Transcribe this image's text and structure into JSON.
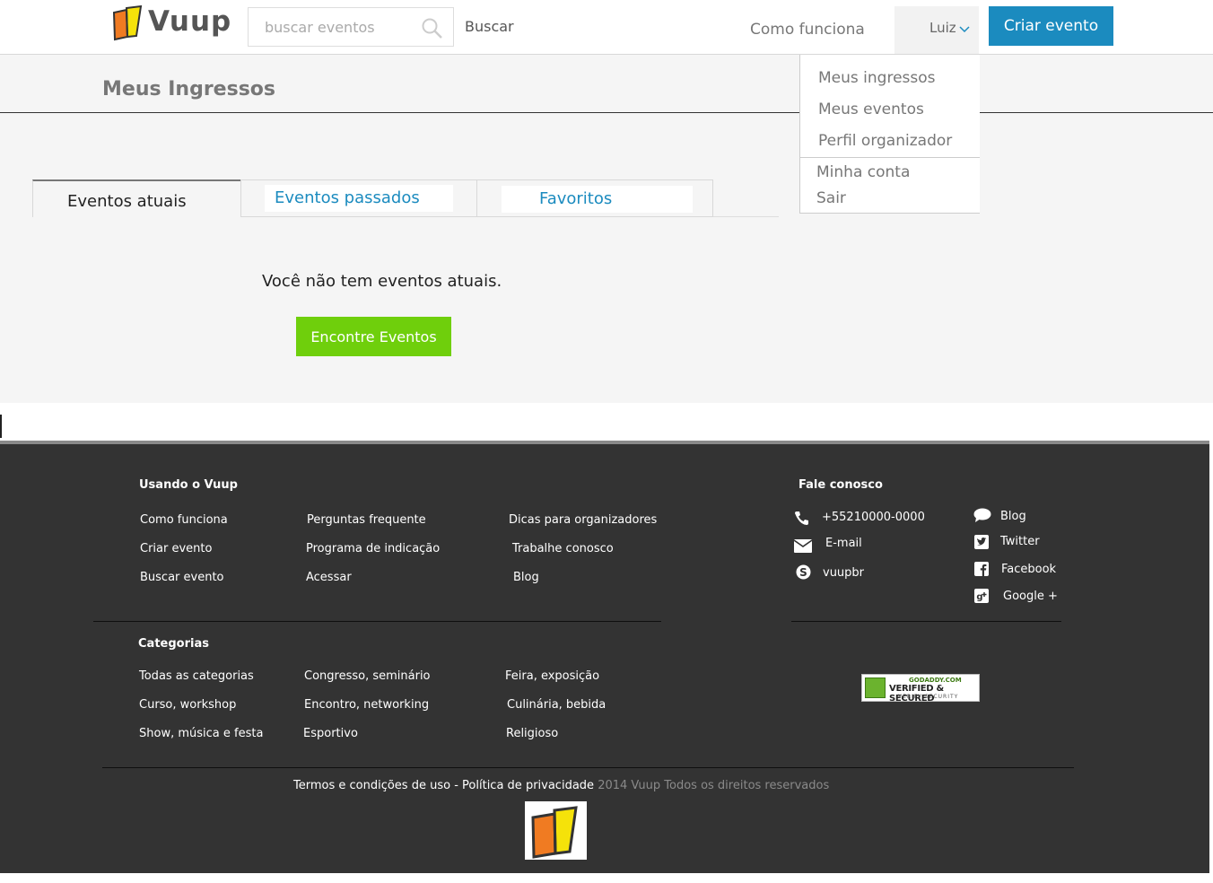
{
  "header": {
    "logo_text": "Vuup",
    "search_placeholder": "buscar eventos",
    "search_label": "Buscar",
    "how_it_works": "Como funciona",
    "user_name": "Luiz",
    "create_event": "Criar evento"
  },
  "dropdown": {
    "items": [
      "Meus ingressos",
      "Meus eventos",
      "Perfil organizador",
      "Minha conta",
      "Sair"
    ]
  },
  "main": {
    "title": "Meus Ingressos",
    "tabs": [
      {
        "label": "Eventos atuais",
        "active": true
      },
      {
        "label": "Eventos passados",
        "active": false
      },
      {
        "label": "Favoritos",
        "active": false
      }
    ],
    "empty_message": "Você não tem eventos atuais.",
    "find_button": "Encontre Eventos"
  },
  "footer": {
    "using_title": "Usando o Vuup",
    "using_links": [
      [
        "Como funciona",
        "Perguntas frequente",
        "Dicas para organizadores"
      ],
      [
        "Criar evento",
        "Programa de indicação",
        "Trabalhe conosco"
      ],
      [
        "Buscar evento",
        "Acessar",
        "Blog"
      ]
    ],
    "contact_title": "Fale conosco",
    "contact": {
      "phone": "+55210000-0000",
      "email": "E-mail",
      "skype": "vuupbr"
    },
    "social": {
      "blog": "Blog",
      "twitter": "Twitter",
      "facebook": "Facebook",
      "google": "Google +"
    },
    "categories_title": "Categorias",
    "categories": [
      [
        "Todas as categorias",
        "Congresso, seminário",
        "Feira, exposição"
      ],
      [
        "Curso, workshop",
        "Encontro, networking",
        "Culinária, bebida"
      ],
      [
        "Show, música e festa",
        "Esportivo",
        "Religioso"
      ]
    ],
    "badge": {
      "top": "GODADDY.COM",
      "middle": "VERIFIED & SECURED",
      "bottom": "VERIFY SECURITY"
    },
    "terms": "Termos e condições de uso",
    "separator": "-",
    "privacy": "Política de privacidade",
    "rights": "2014 Vuup Todos os direitos reservados"
  },
  "colors": {
    "accent_blue": "#1b8bbf",
    "accent_green": "#6fcf0c",
    "footer_bg": "#333333",
    "logo_orange": "#f07b22",
    "logo_yellow": "#f5e20a"
  }
}
